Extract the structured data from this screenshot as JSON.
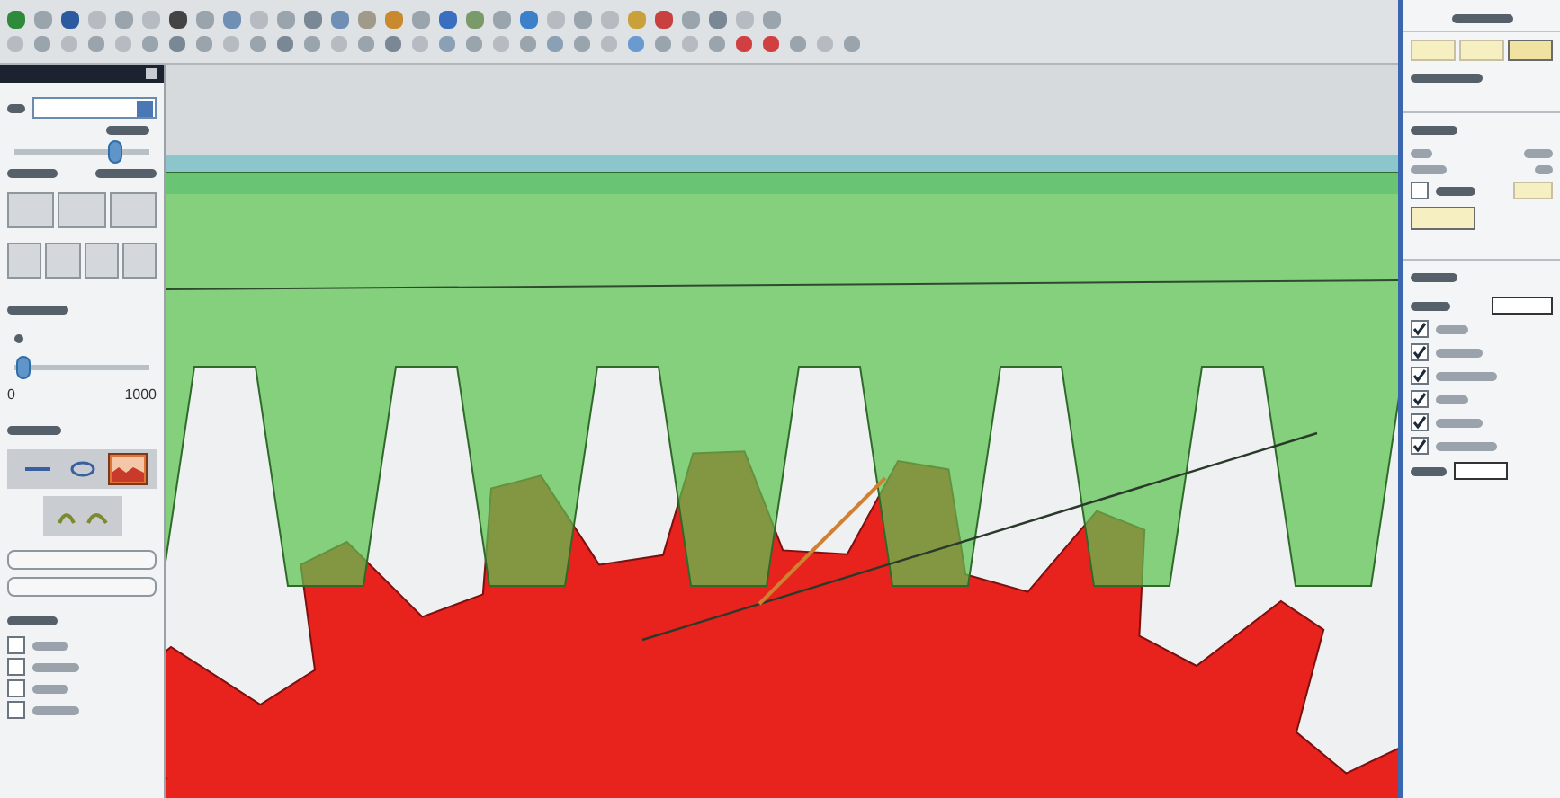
{
  "left_panel": {
    "slider_top": {
      "level": 0.78
    },
    "slider_bottom": {
      "level": 0.02,
      "min_label": "0",
      "max_label": "1000"
    },
    "modes": [
      {
        "kind": "line",
        "selected": false
      },
      {
        "kind": "ring",
        "selected": false
      },
      {
        "kind": "picture",
        "selected": true
      }
    ],
    "checkboxes": [
      {
        "checked": false
      },
      {
        "checked": false
      },
      {
        "checked": false
      },
      {
        "checked": false
      }
    ]
  },
  "right_panel": {
    "tabs": [
      {
        "selected": false
      },
      {
        "selected": false
      },
      {
        "selected": true
      }
    ],
    "area_checkbox": {
      "checked": false
    },
    "checkboxes": [
      {
        "checked": true
      },
      {
        "checked": true
      },
      {
        "checked": true
      },
      {
        "checked": true
      },
      {
        "checked": true
      },
      {
        "checked": true
      }
    ]
  }
}
